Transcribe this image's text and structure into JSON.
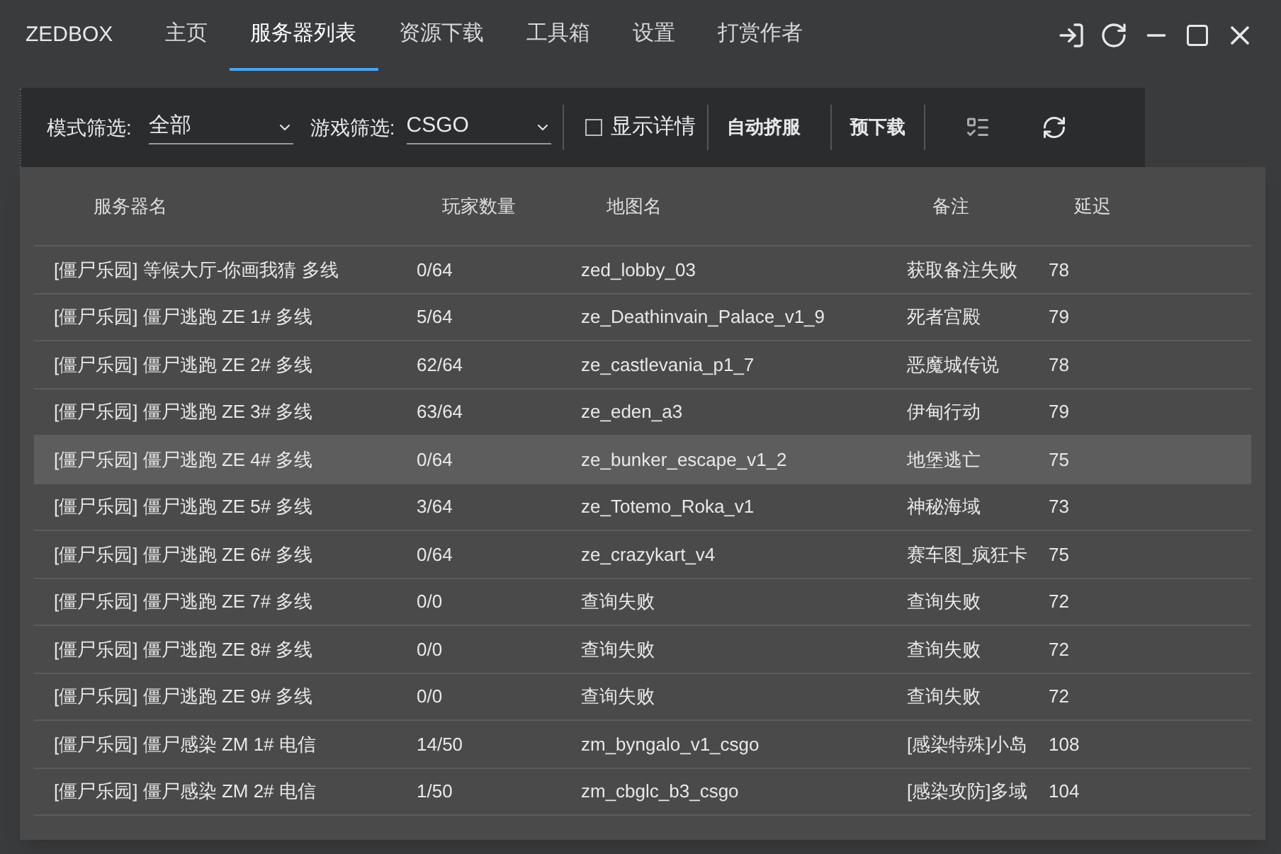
{
  "window": {
    "title": "ZEDBOX"
  },
  "tabs": [
    {
      "label": "主页",
      "selected": false
    },
    {
      "label": "服务器列表",
      "selected": true
    },
    {
      "label": "资源下载",
      "selected": false
    },
    {
      "label": "工具箱",
      "selected": false
    },
    {
      "label": "设置",
      "selected": false
    },
    {
      "label": "打赏作者",
      "selected": false
    }
  ],
  "toolbar": {
    "mode_filter": {
      "label": "模式筛选:",
      "value": "全部"
    },
    "game_filter": {
      "label": "游戏筛选:",
      "value": "CSGO"
    },
    "show_details": {
      "label": "显示详情",
      "checked": false
    },
    "buttons": [
      "自动挤服",
      "预下载"
    ]
  },
  "table": {
    "columns": [
      "服务器名",
      "玩家数量",
      "地图名",
      "备注",
      "延迟"
    ],
    "rows": [
      {
        "cells": [
          "[僵尸乐园] 等候大厅-你画我猜 多线",
          "0/64",
          "zed_lobby_03",
          "获取备注失败",
          "78"
        ],
        "selected": false
      },
      {
        "cells": [
          "[僵尸乐园] 僵尸逃跑 ZE 1# 多线",
          "5/64",
          "ze_Deathinvain_Palace_v1_9",
          "死者宫殿",
          "79"
        ],
        "selected": false
      },
      {
        "cells": [
          "[僵尸乐园] 僵尸逃跑 ZE 2# 多线",
          "62/64",
          "ze_castlevania_p1_7",
          "恶魔城传说",
          "78"
        ],
        "selected": false
      },
      {
        "cells": [
          "[僵尸乐园] 僵尸逃跑 ZE 3# 多线",
          "63/64",
          "ze_eden_a3",
          "伊甸行动",
          "79"
        ],
        "selected": false
      },
      {
        "cells": [
          "[僵尸乐园] 僵尸逃跑 ZE 4# 多线",
          "0/64",
          "ze_bunker_escape_v1_2",
          "地堡逃亡",
          "75"
        ],
        "selected": true
      },
      {
        "cells": [
          "[僵尸乐园] 僵尸逃跑 ZE 5# 多线",
          "3/64",
          "ze_Totemo_Roka_v1",
          "神秘海域",
          "73"
        ],
        "selected": false
      },
      {
        "cells": [
          "[僵尸乐园] 僵尸逃跑 ZE 6# 多线",
          "0/64",
          "ze_crazykart_v4",
          "赛车图_疯狂卡",
          "75"
        ],
        "selected": false
      },
      {
        "cells": [
          "[僵尸乐园] 僵尸逃跑 ZE 7# 多线",
          "0/0",
          "查询失败",
          "查询失败",
          "72"
        ],
        "selected": false
      },
      {
        "cells": [
          "[僵尸乐园] 僵尸逃跑 ZE 8# 多线",
          "0/0",
          "查询失败",
          "查询失败",
          "72"
        ],
        "selected": false
      },
      {
        "cells": [
          "[僵尸乐园] 僵尸逃跑 ZE 9# 多线",
          "0/0",
          "查询失败",
          "查询失败",
          "72"
        ],
        "selected": false
      },
      {
        "cells": [
          "[僵尸乐园] 僵尸感染 ZM 1# 电信",
          "14/50",
          "zm_byngalo_v1_csgo",
          "[感染特殊]小岛",
          "108"
        ],
        "selected": false
      },
      {
        "cells": [
          "[僵尸乐园] 僵尸感染 ZM 2# 电信",
          "1/50",
          "zm_cbglc_b3_csgo",
          "[感染攻防]多域",
          "104"
        ],
        "selected": false
      }
    ]
  }
}
